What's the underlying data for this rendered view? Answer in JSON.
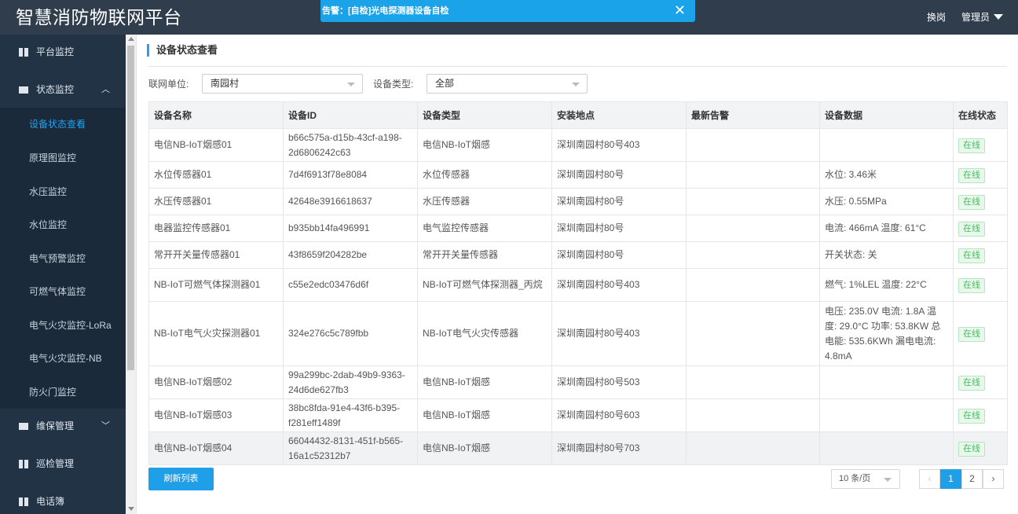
{
  "app": {
    "title": "智慧消防物联网平台"
  },
  "alert": {
    "text": "告警：[自检]光电探测器设备自检",
    "close_icon": "close-icon"
  },
  "header": {
    "switch_label": "换岗",
    "user_label": "管理员"
  },
  "sidebar": {
    "groups": [
      {
        "label": "平台监控",
        "icon": "grid-icon"
      },
      {
        "label": "状态监控",
        "icon": "envelope-icon",
        "chevron": "︿"
      },
      {
        "label": "维保管理",
        "icon": "envelope-icon",
        "chevron": "﹀"
      },
      {
        "label": "巡检管理",
        "icon": "grid-icon"
      },
      {
        "label": "电话簿",
        "icon": "grid-icon"
      }
    ],
    "sub_items": [
      {
        "label": "设备状态查看",
        "active": true
      },
      {
        "label": "原理图监控"
      },
      {
        "label": "水压监控"
      },
      {
        "label": "水位监控"
      },
      {
        "label": "电气预警监控"
      },
      {
        "label": "可燃气体监控"
      },
      {
        "label": "电气火灾监控-LoRa"
      },
      {
        "label": "电气火灾监控-NB"
      },
      {
        "label": "防火门监控"
      }
    ]
  },
  "main": {
    "title": "设备状态查看",
    "filters": {
      "unit_label": "联网单位:",
      "unit_value": "南园村",
      "type_label": "设备类型:",
      "type_value": "全部"
    },
    "table": {
      "columns": [
        "设备名称",
        "设备ID",
        "设备类型",
        "安装地点",
        "最新告警",
        "设备数据",
        "在线状态"
      ],
      "rows": [
        {
          "name": "电信NB-IoT烟感01",
          "id": "b66c575a-d15b-43cf-a198-2d6806242c63",
          "type": "电信NB-IoT烟感",
          "location": "深圳南园村80号403",
          "alarm": "",
          "data": "",
          "status": "在线"
        },
        {
          "name": "水位传感器01",
          "id": "7d4f6913f78e8084",
          "type": "水位传感器",
          "location": "深圳南园村80号",
          "alarm": "",
          "data": "水位: 3.46米",
          "status": "在线"
        },
        {
          "name": "水压传感器01",
          "id": "42648e3916618637",
          "type": "水压传感器",
          "location": "深圳南园村80号",
          "alarm": "",
          "data": "水压: 0.55MPa",
          "status": "在线"
        },
        {
          "name": "电器监控传感器01",
          "id": "b935bb14fa496991",
          "type": "电气监控传感器",
          "location": "深圳南园村80号",
          "alarm": "",
          "data": "电流: 466mA 温度: 61°C",
          "status": "在线"
        },
        {
          "name": "常开开关量传感器01",
          "id": "43f8659f204282be",
          "type": "常开开关量传感器",
          "location": "深圳南园村80号",
          "alarm": "",
          "data": "开关状态: 关",
          "status": "在线"
        },
        {
          "name": "NB-IoT可燃气体探测器01",
          "id": "c55e2edc03476d6f",
          "type": "NB-IoT可燃气体探测器_丙烷",
          "location": "深圳南园村80号403",
          "alarm": "",
          "data": "燃气: 1%LEL 温度: 22°C",
          "status": "在线"
        },
        {
          "name": "NB-IoT电气火灾探测器01",
          "id": "324e276c5c789fbb",
          "type": "NB-IoT电气火灾传感器",
          "location": "深圳南园村80号403",
          "alarm": "",
          "data": "电压: 235.0V 电流: 1.8A 温度: 29.0°C 功率: 53.8KW 总电能: 535.6KWh 漏电电流: 4.8mA",
          "status": "在线"
        },
        {
          "name": "电信NB-IoT烟感02",
          "id": "99a299bc-2dab-49b9-9363-24d6de627fb3",
          "type": "电信NB-IoT烟感",
          "location": "深圳南园村80号503",
          "alarm": "",
          "data": "",
          "status": "在线"
        },
        {
          "name": "电信NB-IoT烟感03",
          "id": "38bc8fda-91e4-43f6-b395-f281eff1489f",
          "type": "电信NB-IoT烟感",
          "location": "深圳南园村80号603",
          "alarm": "",
          "data": "",
          "status": "在线"
        },
        {
          "name": "电信NB-IoT烟感04",
          "id": "66044432-8131-451f-b565-16a1c52312b7",
          "type": "电信NB-IoT烟感",
          "location": "深圳南园村80号703",
          "alarm": "",
          "data": "",
          "status": "在线"
        }
      ]
    },
    "refresh_label": "刷新列表",
    "pagination": {
      "page_size": "10 条/页",
      "prev": "‹",
      "pages": [
        "1",
        "2"
      ],
      "current": "1",
      "next": "›"
    }
  },
  "colors": {
    "topbar": "#2f3d4c",
    "sidebar": "#223345",
    "accent": "#1e9fe8",
    "online": "#4cb965"
  }
}
